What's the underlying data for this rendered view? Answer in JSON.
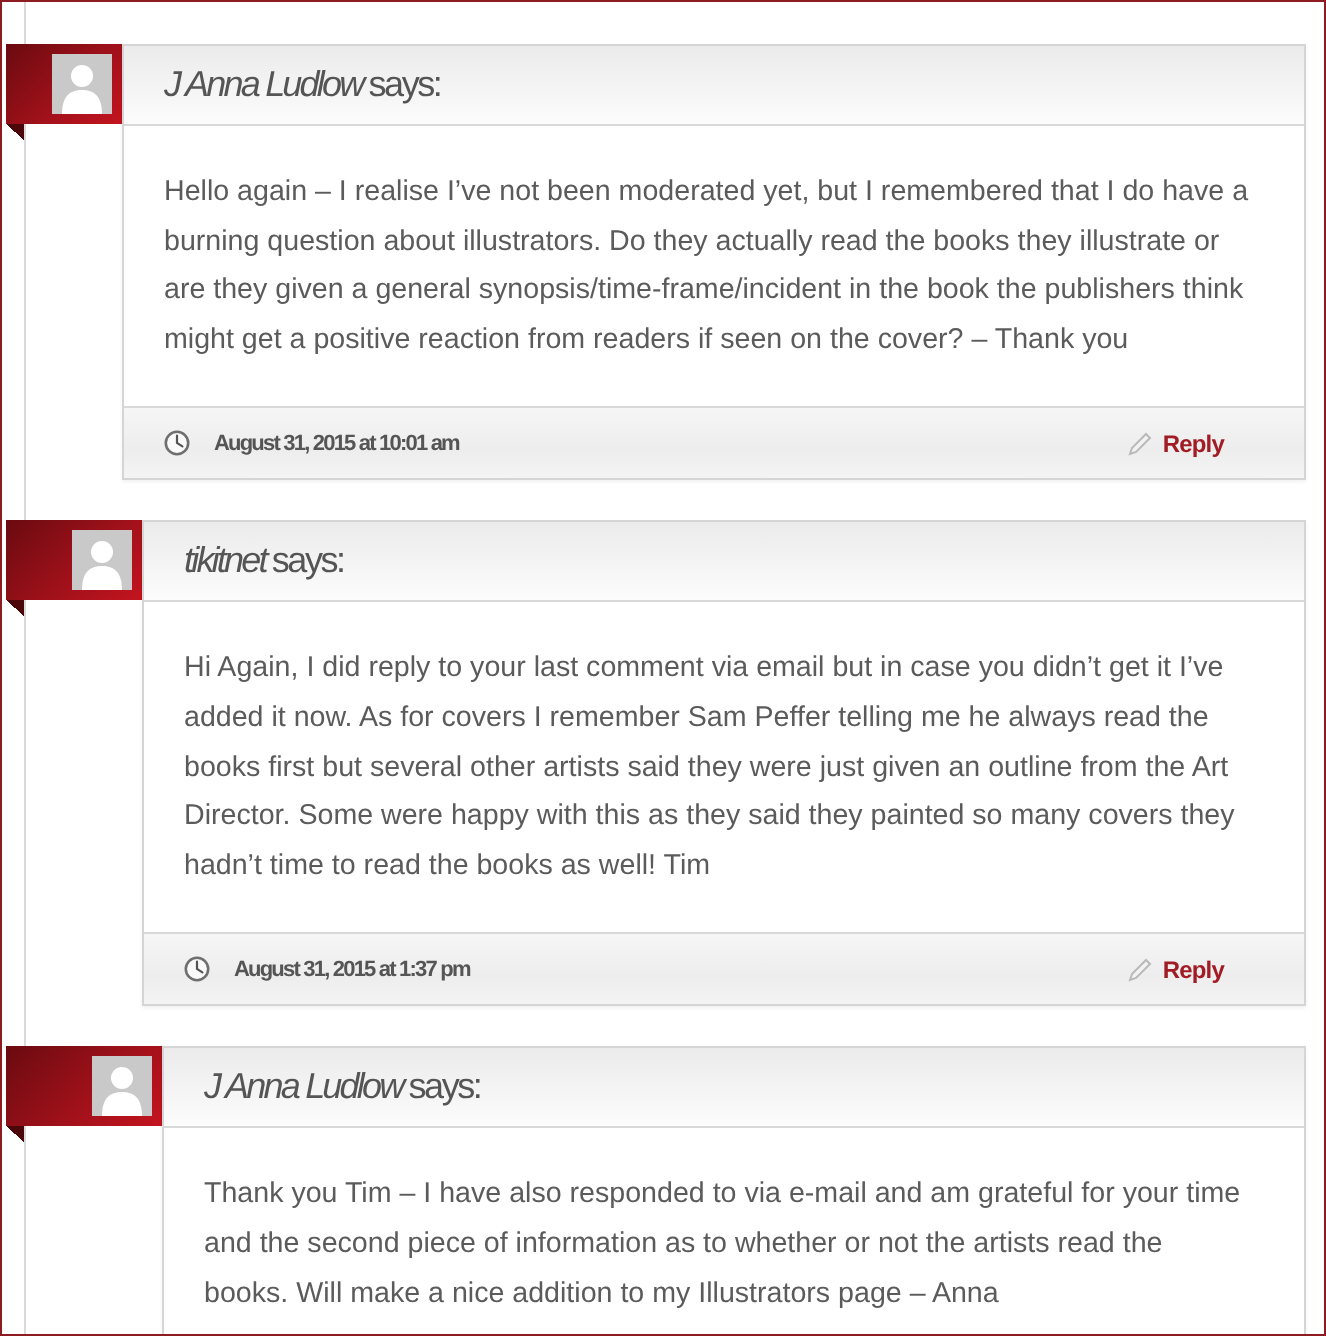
{
  "comments": [
    {
      "author": "J Anna Ludlow",
      "says": "says:",
      "body": "Hello again – I realise I’ve not been moderated yet, but I remembered that I do have a burning question about illustrators. Do they actually read the books they illustrate or are they given a general synopsis/time-frame/incident in the book the publishers think might get a positive reaction from readers if seen on the cover? – Thank you",
      "date": "August 31, 2015 at 10:01 am",
      "reply": "Reply",
      "children": [
        {
          "author": "tikitnet",
          "says": "says:",
          "body": "Hi Again, I did reply to your last comment via email but in case you didn’t get it I’ve added it now. As for covers I remember Sam Peffer telling me he always read the books first but several other artists said they were just given an outline from the Art Director. Some were happy with this as they said they painted so many covers they hadn’t time to read the books as well! Tim",
          "date": "August 31, 2015 at 1:37 pm",
          "reply": "Reply",
          "children": [
            {
              "author": "J Anna Ludlow",
              "says": "says:",
              "body": "Thank you Tim – I have also responded to via e-mail and am grateful for your time and the second piece of information as to whether or not the artists read the books. Will make a nice addition to my Illustrators page – Anna"
            }
          ]
        }
      ]
    }
  ]
}
